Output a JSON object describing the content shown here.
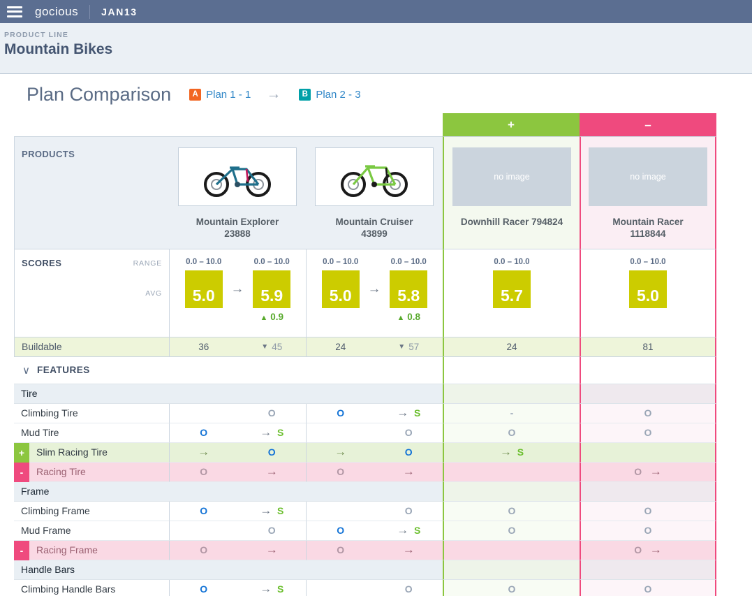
{
  "topbar": {
    "brand": "gocious",
    "date_tag": "JAN13",
    "menu_icon": "hamburger-icon"
  },
  "breadcrumb": {
    "kicker": "PRODUCT LINE",
    "title": "Mountain Bikes"
  },
  "heading": {
    "title": "Plan Comparison",
    "plan_a_badge": "A",
    "plan_a_label": "Plan 1 - 1",
    "arrow": "→",
    "plan_b_badge": "B",
    "plan_b_label": "Plan 2 - 3"
  },
  "colors": {
    "brand_navy": "#5b6e91",
    "plan_a": "#f26522",
    "plan_b": "#00a0a8",
    "add_green": "#8cc63f",
    "remove_pink": "#ef4a7e",
    "score_olive": "#cccc00",
    "link_blue": "#2f86c7"
  },
  "strip": {
    "add_symbol": "+",
    "remove_symbol": "–"
  },
  "sections": {
    "products_label": "PRODUCTS",
    "scores_label": "SCORES",
    "range_label": "RANGE",
    "avg_label": "AVG",
    "buildable_label": "Buildable",
    "features_label": "FEATURES",
    "features_chevron": "chevron-down-icon"
  },
  "products": [
    {
      "name": "Mountain Explorer\n23888",
      "has_image": true,
      "kind": "plan"
    },
    {
      "name": "Mountain Cruiser\n43899",
      "has_image": true,
      "kind": "plan"
    },
    {
      "name": "Downhill Racer 794824",
      "has_image": false,
      "kind": "added",
      "no_image_text": "no image"
    },
    {
      "name": "Mountain Racer\n1118844",
      "has_image": false,
      "kind": "removed",
      "no_image_text": "no image"
    }
  ],
  "scores": {
    "range_text": "0.0 – 10.0",
    "columns": [
      {
        "before": "5.0",
        "after": "5.9",
        "delta": "0.9",
        "delta_dir": "up"
      },
      {
        "before": "5.0",
        "after": "5.8",
        "delta": "0.8",
        "delta_dir": "up"
      }
    ],
    "single": [
      {
        "value": "5.7"
      },
      {
        "value": "5.0"
      }
    ]
  },
  "buildable": {
    "columns": [
      {
        "before": "36",
        "after": "45",
        "dir": "down"
      },
      {
        "before": "24",
        "after": "57",
        "dir": "down"
      }
    ],
    "single": [
      "24",
      "81"
    ]
  },
  "feature_groups": [
    {
      "name": "Tire",
      "rows": [
        {
          "label": "Climbing Tire",
          "tag": "",
          "a": [
            "",
            "O-grey"
          ],
          "b": [
            "O-blue",
            "S"
          ],
          "c": "-",
          "d": "O-grey"
        },
        {
          "label": "Mud Tire",
          "tag": "",
          "a": [
            "O-blue",
            "S"
          ],
          "b": [
            "",
            "O-grey"
          ],
          "c": "O-grey",
          "d": "O-grey"
        },
        {
          "label": "Slim Racing Tire",
          "tag": "+",
          "a": [
            "",
            "O-blue"
          ],
          "b": [
            "",
            "O-blue"
          ],
          "c": "S",
          "d": ""
        },
        {
          "label": "Racing Tire",
          "tag": "-",
          "a": [
            "O-dim",
            ""
          ],
          "b": [
            "O-dim",
            ""
          ],
          "c": "",
          "d": "O-dim-arrow"
        }
      ]
    },
    {
      "name": "Frame",
      "rows": [
        {
          "label": "Climbing Frame",
          "tag": "",
          "a": [
            "O-blue",
            "S"
          ],
          "b": [
            "",
            "O-grey"
          ],
          "c": "O-grey",
          "d": "O-grey"
        },
        {
          "label": "Mud Frame",
          "tag": "",
          "a": [
            "",
            "O-grey"
          ],
          "b": [
            "O-blue",
            "S"
          ],
          "c": "O-grey",
          "d": "O-grey"
        },
        {
          "label": "Racing Frame",
          "tag": "-",
          "a": [
            "O-dim",
            ""
          ],
          "b": [
            "O-dim",
            ""
          ],
          "c": "",
          "d": "O-dim-arrow"
        }
      ]
    },
    {
      "name": "Handle Bars",
      "rows": [
        {
          "label": "Climbing Handle Bars",
          "tag": "",
          "a": [
            "O-blue",
            "S"
          ],
          "b": [
            "",
            "O-grey"
          ],
          "c": "O-grey",
          "d": "O-grey"
        }
      ]
    }
  ]
}
